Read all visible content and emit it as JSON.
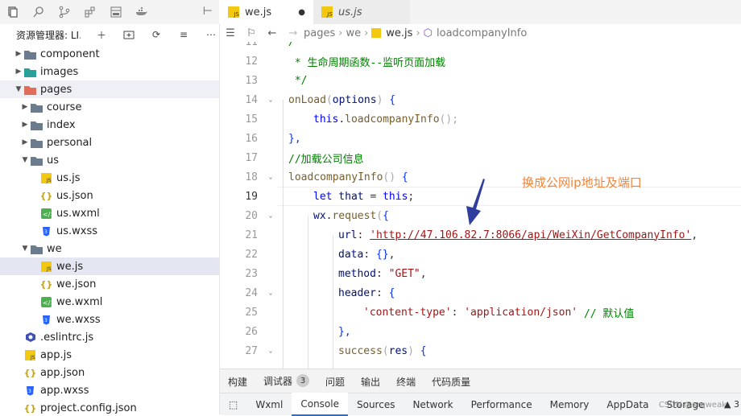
{
  "explorer": {
    "title": "资源管理器: LI..."
  },
  "tree": [
    {
      "label": "component",
      "depth": 1,
      "type": "folder",
      "open": false,
      "color": "#6b7c8f"
    },
    {
      "label": "images",
      "depth": 1,
      "type": "folder",
      "open": false,
      "color": "#2aa198"
    },
    {
      "label": "pages",
      "depth": 1,
      "type": "folder",
      "open": true,
      "color": "#e06c5a",
      "hl": true
    },
    {
      "label": "course",
      "depth": 2,
      "type": "folder",
      "open": false,
      "color": "#6b7c8f"
    },
    {
      "label": "index",
      "depth": 2,
      "type": "folder",
      "open": false,
      "color": "#6b7c8f"
    },
    {
      "label": "personal",
      "depth": 2,
      "type": "folder",
      "open": false,
      "color": "#6b7c8f"
    },
    {
      "label": "us",
      "depth": 2,
      "type": "folder",
      "open": true,
      "color": "#6b7c8f"
    },
    {
      "label": "us.js",
      "depth": 3,
      "type": "js"
    },
    {
      "label": "us.json",
      "depth": 3,
      "type": "json"
    },
    {
      "label": "us.wxml",
      "depth": 3,
      "type": "wxml"
    },
    {
      "label": "us.wxss",
      "depth": 3,
      "type": "wxss"
    },
    {
      "label": "we",
      "depth": 2,
      "type": "folder",
      "open": true,
      "color": "#6b7c8f"
    },
    {
      "label": "we.js",
      "depth": 3,
      "type": "js",
      "active": true
    },
    {
      "label": "we.json",
      "depth": 3,
      "type": "json"
    },
    {
      "label": "we.wxml",
      "depth": 3,
      "type": "wxml"
    },
    {
      "label": "we.wxss",
      "depth": 3,
      "type": "wxss"
    },
    {
      "label": ".eslintrc.js",
      "depth": 1,
      "type": "eslint"
    },
    {
      "label": "app.js",
      "depth": 1,
      "type": "js"
    },
    {
      "label": "app.json",
      "depth": 1,
      "type": "json"
    },
    {
      "label": "app.wxss",
      "depth": 1,
      "type": "wxss"
    },
    {
      "label": "project.config.json",
      "depth": 1,
      "type": "json"
    }
  ],
  "tabs": [
    {
      "label": "we.js",
      "modified_marker": "●"
    },
    {
      "label": "us.js"
    }
  ],
  "breadcrumb": {
    "parts": [
      "pages",
      "we",
      "we.js",
      "loadcompanyInfo"
    ]
  },
  "editor": {
    "lines": [
      {
        "n": "11",
        "fold": false,
        "indent": 0,
        "seg": [
          [
            "c",
            "/**"
          ]
        ]
      },
      {
        "n": "12",
        "fold": false,
        "indent": 0,
        "seg": [
          [
            "c",
            " * 生命周期函数--监听页面加载"
          ]
        ]
      },
      {
        "n": "13",
        "fold": false,
        "indent": 0,
        "seg": [
          [
            "c",
            " */"
          ]
        ]
      },
      {
        "n": "14",
        "fold": true,
        "indent": 0,
        "seg": [
          [
            "f",
            "onLoad"
          ],
          [
            "p",
            "("
          ],
          [
            "v",
            "options"
          ],
          [
            "p",
            ")"
          ],
          [
            "b",
            " {"
          ]
        ]
      },
      {
        "n": "15",
        "fold": false,
        "indent": 1,
        "seg": [
          [
            "k",
            "this"
          ],
          [
            "t",
            "."
          ],
          [
            "f",
            "loadcompanyInfo"
          ],
          [
            "p",
            "();"
          ]
        ]
      },
      {
        "n": "16",
        "fold": false,
        "indent": 0,
        "seg": [
          [
            "b",
            "},"
          ]
        ]
      },
      {
        "n": "17",
        "fold": false,
        "indent": 0,
        "seg": [
          [
            "c",
            "//加载公司信息"
          ]
        ]
      },
      {
        "n": "18",
        "fold": true,
        "indent": 0,
        "seg": [
          [
            "f",
            "loadcompanyInfo"
          ],
          [
            "p",
            "()"
          ],
          [
            "b",
            " {"
          ]
        ]
      },
      {
        "n": "19",
        "fold": false,
        "indent": 1,
        "cur": true,
        "seg": [
          [
            "k",
            "let"
          ],
          [
            "v",
            " that"
          ],
          [
            "t",
            " = "
          ],
          [
            "k",
            "this"
          ],
          [
            "t",
            ";"
          ]
        ]
      },
      {
        "n": "20",
        "fold": true,
        "indent": 1,
        "seg": [
          [
            "v",
            "wx"
          ],
          [
            "t",
            "."
          ],
          [
            "f",
            "request"
          ],
          [
            "p",
            "("
          ],
          [
            "b",
            "{"
          ]
        ]
      },
      {
        "n": "21",
        "fold": false,
        "indent": 2,
        "seg": [
          [
            "v",
            "url"
          ],
          [
            "t",
            ": "
          ],
          [
            "s",
            "'http://47.106.82.7:8066/api/WeiXin/GetCompanyInfo'"
          ],
          [
            "t",
            ","
          ]
        ]
      },
      {
        "n": "22",
        "fold": false,
        "indent": 2,
        "seg": [
          [
            "v",
            "data"
          ],
          [
            "t",
            ": "
          ],
          [
            "b",
            "{}"
          ],
          [
            "t",
            ","
          ]
        ]
      },
      {
        "n": "23",
        "fold": false,
        "indent": 2,
        "seg": [
          [
            "v",
            "method"
          ],
          [
            "t",
            ": "
          ],
          [
            "s",
            "\"GET\""
          ],
          [
            "t",
            ","
          ]
        ]
      },
      {
        "n": "24",
        "fold": true,
        "indent": 2,
        "seg": [
          [
            "v",
            "header"
          ],
          [
            "t",
            ": "
          ],
          [
            "b",
            "{"
          ]
        ]
      },
      {
        "n": "25",
        "fold": false,
        "indent": 3,
        "seg": [
          [
            "s",
            "'content-type'"
          ],
          [
            "t",
            ": "
          ],
          [
            "s",
            "'application/json'"
          ],
          [
            "c",
            " // 默认值"
          ]
        ]
      },
      {
        "n": "26",
        "fold": false,
        "indent": 2,
        "seg": [
          [
            "b",
            "},"
          ]
        ]
      },
      {
        "n": "27",
        "fold": true,
        "indent": 2,
        "seg": [
          [
            "f",
            "success"
          ],
          [
            "p",
            "("
          ],
          [
            "v",
            "res"
          ],
          [
            "p",
            ")"
          ],
          [
            "b",
            " {"
          ]
        ]
      }
    ],
    "annotation": "换成公网ip地址及端口"
  },
  "panel_tabs": [
    "构建",
    "调试器",
    "问题",
    "输出",
    "终端",
    "代码质量"
  ],
  "panel_badge": "3",
  "devtools_tabs": [
    "Wxml",
    "Console",
    "Sources",
    "Network",
    "Performance",
    "Memory",
    "AppData",
    "Storage"
  ],
  "watermark": "CSDN @xrqweak",
  "warn_count": "3"
}
